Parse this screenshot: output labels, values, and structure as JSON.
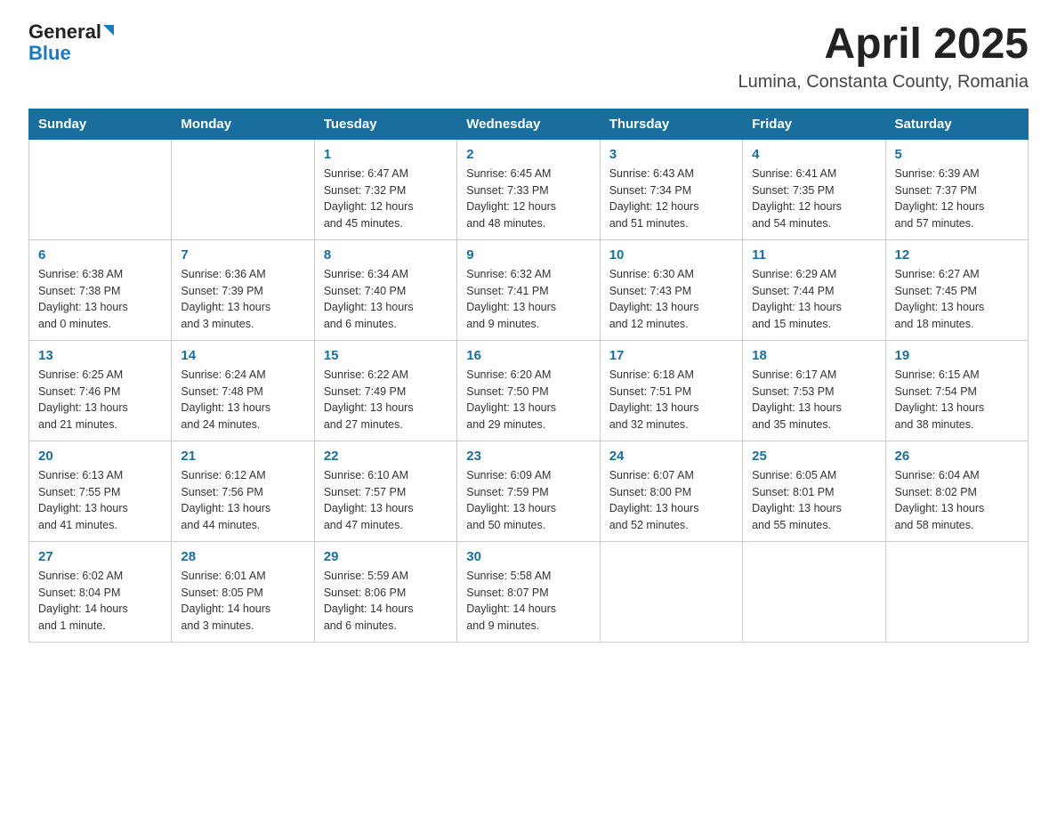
{
  "header": {
    "logo_general": "General",
    "logo_blue": "Blue",
    "month_title": "April 2025",
    "location": "Lumina, Constanta County, Romania"
  },
  "weekdays": [
    "Sunday",
    "Monday",
    "Tuesday",
    "Wednesday",
    "Thursday",
    "Friday",
    "Saturday"
  ],
  "weeks": [
    [
      {
        "day": "",
        "info": ""
      },
      {
        "day": "",
        "info": ""
      },
      {
        "day": "1",
        "info": "Sunrise: 6:47 AM\nSunset: 7:32 PM\nDaylight: 12 hours\nand 45 minutes."
      },
      {
        "day": "2",
        "info": "Sunrise: 6:45 AM\nSunset: 7:33 PM\nDaylight: 12 hours\nand 48 minutes."
      },
      {
        "day": "3",
        "info": "Sunrise: 6:43 AM\nSunset: 7:34 PM\nDaylight: 12 hours\nand 51 minutes."
      },
      {
        "day": "4",
        "info": "Sunrise: 6:41 AM\nSunset: 7:35 PM\nDaylight: 12 hours\nand 54 minutes."
      },
      {
        "day": "5",
        "info": "Sunrise: 6:39 AM\nSunset: 7:37 PM\nDaylight: 12 hours\nand 57 minutes."
      }
    ],
    [
      {
        "day": "6",
        "info": "Sunrise: 6:38 AM\nSunset: 7:38 PM\nDaylight: 13 hours\nand 0 minutes."
      },
      {
        "day": "7",
        "info": "Sunrise: 6:36 AM\nSunset: 7:39 PM\nDaylight: 13 hours\nand 3 minutes."
      },
      {
        "day": "8",
        "info": "Sunrise: 6:34 AM\nSunset: 7:40 PM\nDaylight: 13 hours\nand 6 minutes."
      },
      {
        "day": "9",
        "info": "Sunrise: 6:32 AM\nSunset: 7:41 PM\nDaylight: 13 hours\nand 9 minutes."
      },
      {
        "day": "10",
        "info": "Sunrise: 6:30 AM\nSunset: 7:43 PM\nDaylight: 13 hours\nand 12 minutes."
      },
      {
        "day": "11",
        "info": "Sunrise: 6:29 AM\nSunset: 7:44 PM\nDaylight: 13 hours\nand 15 minutes."
      },
      {
        "day": "12",
        "info": "Sunrise: 6:27 AM\nSunset: 7:45 PM\nDaylight: 13 hours\nand 18 minutes."
      }
    ],
    [
      {
        "day": "13",
        "info": "Sunrise: 6:25 AM\nSunset: 7:46 PM\nDaylight: 13 hours\nand 21 minutes."
      },
      {
        "day": "14",
        "info": "Sunrise: 6:24 AM\nSunset: 7:48 PM\nDaylight: 13 hours\nand 24 minutes."
      },
      {
        "day": "15",
        "info": "Sunrise: 6:22 AM\nSunset: 7:49 PM\nDaylight: 13 hours\nand 27 minutes."
      },
      {
        "day": "16",
        "info": "Sunrise: 6:20 AM\nSunset: 7:50 PM\nDaylight: 13 hours\nand 29 minutes."
      },
      {
        "day": "17",
        "info": "Sunrise: 6:18 AM\nSunset: 7:51 PM\nDaylight: 13 hours\nand 32 minutes."
      },
      {
        "day": "18",
        "info": "Sunrise: 6:17 AM\nSunset: 7:53 PM\nDaylight: 13 hours\nand 35 minutes."
      },
      {
        "day": "19",
        "info": "Sunrise: 6:15 AM\nSunset: 7:54 PM\nDaylight: 13 hours\nand 38 minutes."
      }
    ],
    [
      {
        "day": "20",
        "info": "Sunrise: 6:13 AM\nSunset: 7:55 PM\nDaylight: 13 hours\nand 41 minutes."
      },
      {
        "day": "21",
        "info": "Sunrise: 6:12 AM\nSunset: 7:56 PM\nDaylight: 13 hours\nand 44 minutes."
      },
      {
        "day": "22",
        "info": "Sunrise: 6:10 AM\nSunset: 7:57 PM\nDaylight: 13 hours\nand 47 minutes."
      },
      {
        "day": "23",
        "info": "Sunrise: 6:09 AM\nSunset: 7:59 PM\nDaylight: 13 hours\nand 50 minutes."
      },
      {
        "day": "24",
        "info": "Sunrise: 6:07 AM\nSunset: 8:00 PM\nDaylight: 13 hours\nand 52 minutes."
      },
      {
        "day": "25",
        "info": "Sunrise: 6:05 AM\nSunset: 8:01 PM\nDaylight: 13 hours\nand 55 minutes."
      },
      {
        "day": "26",
        "info": "Sunrise: 6:04 AM\nSunset: 8:02 PM\nDaylight: 13 hours\nand 58 minutes."
      }
    ],
    [
      {
        "day": "27",
        "info": "Sunrise: 6:02 AM\nSunset: 8:04 PM\nDaylight: 14 hours\nand 1 minute."
      },
      {
        "day": "28",
        "info": "Sunrise: 6:01 AM\nSunset: 8:05 PM\nDaylight: 14 hours\nand 3 minutes."
      },
      {
        "day": "29",
        "info": "Sunrise: 5:59 AM\nSunset: 8:06 PM\nDaylight: 14 hours\nand 6 minutes."
      },
      {
        "day": "30",
        "info": "Sunrise: 5:58 AM\nSunset: 8:07 PM\nDaylight: 14 hours\nand 9 minutes."
      },
      {
        "day": "",
        "info": ""
      },
      {
        "day": "",
        "info": ""
      },
      {
        "day": "",
        "info": ""
      }
    ]
  ]
}
